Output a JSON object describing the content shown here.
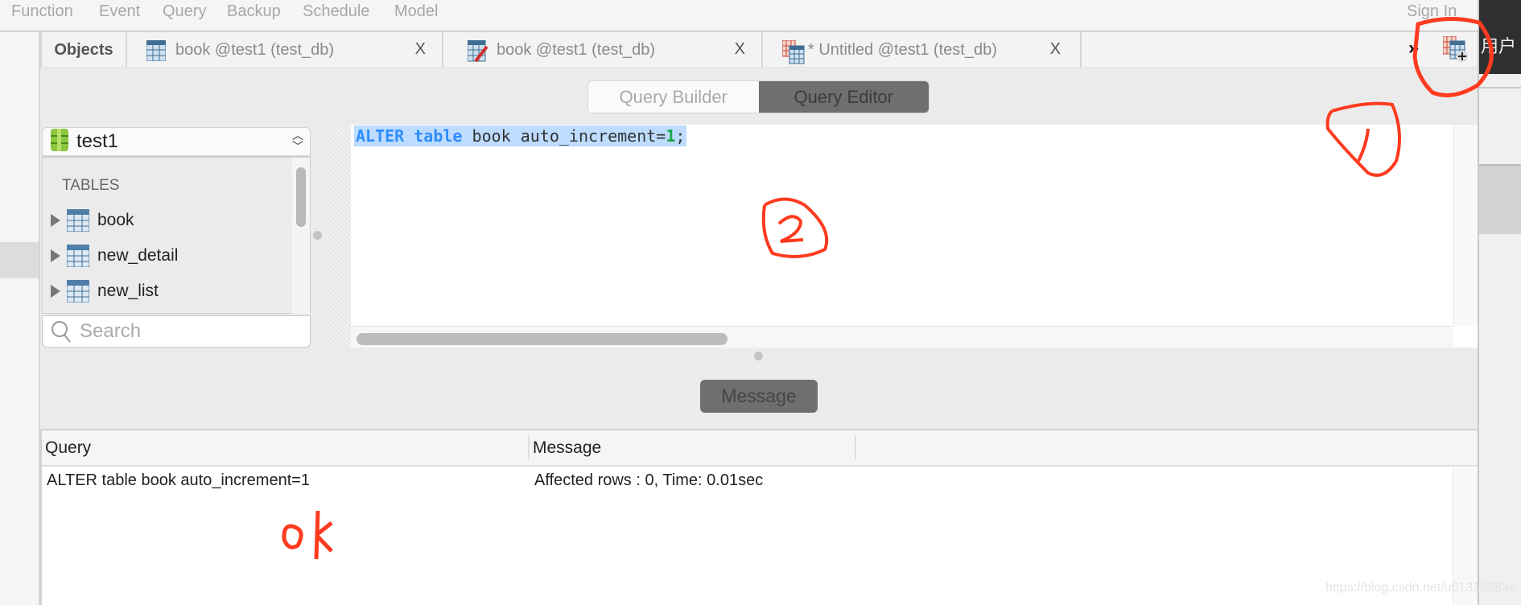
{
  "menu": [
    "Function",
    "Event",
    "Query",
    "Backup",
    "Schedule",
    "Model"
  ],
  "sign_in": "Sign In",
  "tabs": {
    "objects": "Objects",
    "items": [
      {
        "label": "book @test1 (test_db)",
        "close": "X",
        "icon": "table-icon"
      },
      {
        "label": "book @test1 (test_db)",
        "close": "X",
        "icon": "table-edit-icon"
      },
      {
        "label": "* Untitled @test1 (test_db)",
        "close": "X",
        "icon": "query-icon"
      }
    ],
    "overflow": "»",
    "new_query_icon": "new-query-icon"
  },
  "right_panel_label": "用户",
  "mode": {
    "builder": "Query Builder",
    "editor": "Query Editor",
    "active": "editor"
  },
  "sidebar": {
    "database": "test1",
    "section": "TABLES",
    "tables": [
      "book",
      "new_detail",
      "new_list"
    ],
    "search_placeholder": "Search"
  },
  "editor": {
    "keyword1": "ALTER",
    "keyword2": "table",
    "rest": " book auto_increment=",
    "number": "1",
    "end": ";"
  },
  "message_tab": "Message",
  "results": {
    "columns": [
      "Query",
      "Message"
    ],
    "rows": [
      {
        "query": "ALTER table book auto_increment=1",
        "message": "Affected rows : 0, Time: 0.01sec"
      }
    ]
  },
  "annotations": [
    "1",
    "2",
    "ok"
  ],
  "watermark": "https://blog.csdn.net/u013163834",
  "colors": {
    "keyword": "#2f8dfc",
    "number": "#1aa84a",
    "selection": "#bddcff",
    "annotation": "#ff3b1f",
    "active_segment": "#6f6f6f"
  }
}
